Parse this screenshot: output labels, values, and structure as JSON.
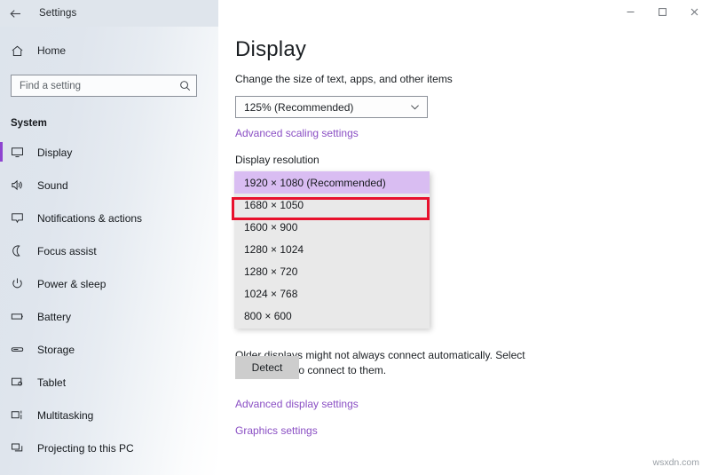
{
  "window": {
    "title": "Settings",
    "back_icon": "back-arrow-icon",
    "minimize_label": "Minimize",
    "maximize_label": "Maximize",
    "close_label": "Close"
  },
  "sidebar": {
    "home_label": "Home",
    "home_icon": "home-icon",
    "search": {
      "placeholder": "Find a setting",
      "value": "",
      "icon": "search-icon"
    },
    "section_title": "System",
    "items": [
      {
        "label": "Display",
        "icon": "monitor-icon",
        "selected": true
      },
      {
        "label": "Sound",
        "icon": "speaker-icon",
        "selected": false
      },
      {
        "label": "Notifications & actions",
        "icon": "notification-icon",
        "selected": false
      },
      {
        "label": "Focus assist",
        "icon": "moon-icon",
        "selected": false
      },
      {
        "label": "Power & sleep",
        "icon": "power-icon",
        "selected": false
      },
      {
        "label": "Battery",
        "icon": "battery-icon",
        "selected": false
      },
      {
        "label": "Storage",
        "icon": "storage-icon",
        "selected": false
      },
      {
        "label": "Tablet",
        "icon": "tablet-icon",
        "selected": false
      },
      {
        "label": "Multitasking",
        "icon": "multitasking-icon",
        "selected": false
      },
      {
        "label": "Projecting to this PC",
        "icon": "projecting-icon",
        "selected": false
      }
    ]
  },
  "main": {
    "page_title": "Display",
    "scale": {
      "label": "Change the size of text, apps, and other items",
      "value": "125% (Recommended)",
      "chevron_icon": "chevron-down-icon"
    },
    "advanced_scaling_link": "Advanced scaling settings",
    "resolution": {
      "label": "Display resolution",
      "selected": "1920 × 1080 (Recommended)",
      "options": [
        "1920 × 1080 (Recommended)",
        "1680 × 1050",
        "1600 × 900",
        "1280 × 1024",
        "1280 × 720",
        "1024 × 768",
        "800 × 600"
      ]
    },
    "detect": {
      "description": "Older displays might not always connect automatically. Select Detect to try to connect to them.",
      "button_label": "Detect"
    },
    "advanced_display_link": "Advanced display settings",
    "graphics_link": "Graphics settings"
  },
  "annotation": {
    "color": "#e8112d",
    "target": "1920 × 1080 (Recommended)"
  },
  "watermark": "wsxdn.com"
}
